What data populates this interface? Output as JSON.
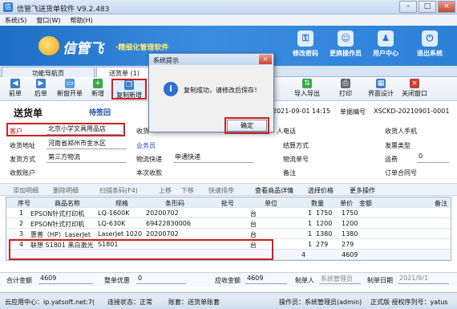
{
  "window": {
    "title": "信管飞送货单软件 V9.2.483",
    "min": "–",
    "max": "□",
    "close": "×"
  },
  "menu": [
    "系统(S)",
    "窗口(W)",
    "帮助(H)"
  ],
  "banner": {
    "brand": "信管飞",
    "slogan": "·精细化管理软件",
    "buttons": [
      {
        "label": "修改密码",
        "icon": "key-icon"
      },
      {
        "label": "更换操作员",
        "icon": "users-icon"
      },
      {
        "label": "用户中心",
        "icon": "user-icon"
      },
      {
        "label": "退出系统",
        "icon": "power-icon"
      }
    ]
  },
  "tabs": [
    "功能导航页",
    "送货单 (1)"
  ],
  "toolbar": [
    {
      "label": "前单"
    },
    {
      "label": "后单"
    },
    {
      "label": "新窗开单"
    },
    {
      "label": "新增"
    },
    {
      "label": "复制新增"
    },
    {
      "label": "导入导出"
    },
    {
      "label": "打印"
    },
    {
      "label": "界面设计"
    },
    {
      "label": "关闭窗口"
    }
  ],
  "form": {
    "title": "送货单",
    "status": "待签回",
    "date": "2021-09-01 14:15",
    "order_no_label": "单据编号",
    "order_no": "XSCKD-20210901-0001",
    "fields": {
      "customer_label": "客户",
      "customer": "北京小学文具用品店",
      "contact_label": "收货",
      "phone_label": "人电话",
      "mobile_label": "收货人手机",
      "address_label": "收货地址",
      "address": "河南省郑州市金水区",
      "salesman_label": "业务员",
      "settle_label": "结算方式",
      "invoice_label": "发票类型",
      "ship_label": "发货方式",
      "ship": "第三方物流",
      "logistics_label": "物流快递",
      "logistics": "申通快递",
      "tracking_label": "物流单号",
      "freight_label": "运费",
      "freight": "0",
      "account_label": "收款账户",
      "received_label": "本次收款",
      "remark_label": "备注",
      "contract_label": "订单合同号"
    }
  },
  "gridbar": [
    "添加明细",
    "删除明细",
    "扫描条码(F4)",
    "上移",
    "下移",
    "快速排序",
    "查看商品详情",
    "选择价格",
    "更多操作"
  ],
  "grid": {
    "headers": [
      "序号",
      "商品名称",
      "规格",
      "条形码",
      "批号",
      "单位",
      "数量",
      "单价",
      "金额",
      "备注"
    ],
    "rows": [
      [
        "1",
        "EPSON针式打印机",
        "LQ-1600K",
        "20200702",
        "",
        "台",
        "1",
        "1750",
        "1750",
        ""
      ],
      [
        "2",
        "EPSON针式打印机",
        "LQ-630K",
        "69422830006",
        "",
        "台",
        "1",
        "1200",
        "1200",
        ""
      ],
      [
        "3",
        "惠普（HP）LaserJet",
        "LaserJet 1020",
        "20200702",
        "",
        "台",
        "1",
        "1380",
        "1380",
        ""
      ],
      [
        "4",
        "联想 S1801 黑白激光",
        "S1801",
        "",
        "",
        "台",
        "1",
        "279",
        "279",
        ""
      ]
    ],
    "total_qty": "4",
    "total_amount": "4609"
  },
  "summary": {
    "total_label": "合计金额",
    "total": "4609",
    "discount_label": "整单优惠",
    "discount": "0",
    "receivable_label": "应收金额",
    "receivable": "4609",
    "maker_label": "制单人",
    "maker": "系统管理员",
    "date_label": "制单日期",
    "date": "2021/9/1"
  },
  "statusbar": {
    "cloud": "云应用中心：ip.yatsoft.net:7(",
    "conn": "连接状态：正常",
    "account": "账套：送货单账套",
    "operator": "操作员：系统管理员(admin)",
    "license": "正式版 授权序列号：yatus"
  },
  "dialog": {
    "title": "系统提示",
    "message": "复制成功，请修改后保存！",
    "ok": "确定",
    "close": "×"
  }
}
